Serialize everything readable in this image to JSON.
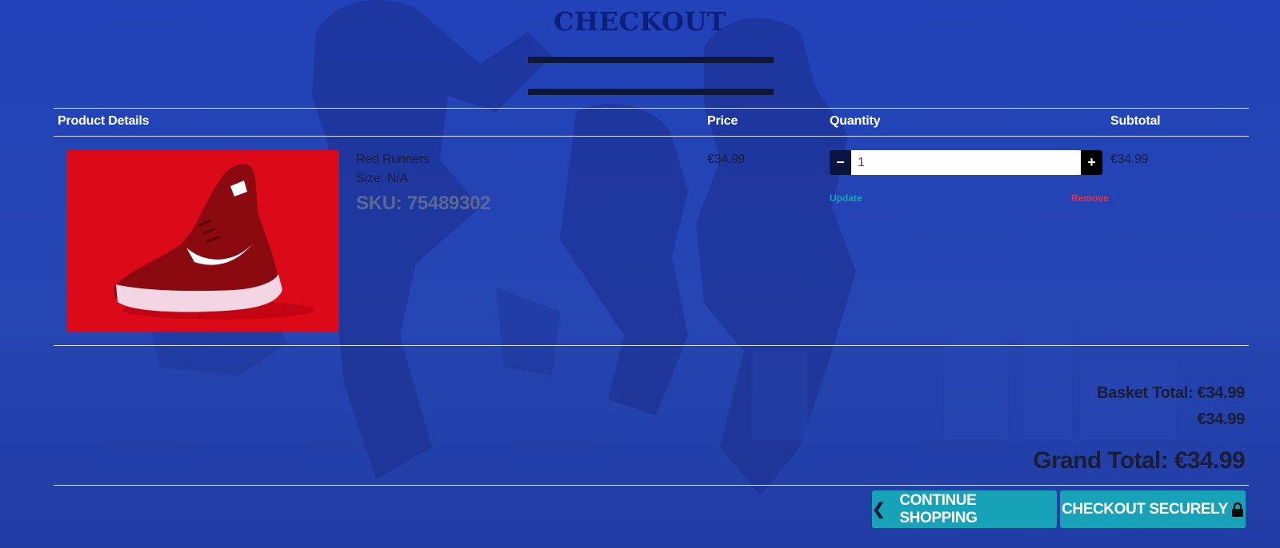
{
  "page": {
    "title": "CHECKOUT"
  },
  "table": {
    "headers": {
      "product_details": "Product Details",
      "price": "Price",
      "quantity": "Quantity",
      "subtotal": "Subtotal"
    }
  },
  "items": [
    {
      "name": "Red Runners",
      "size": "Size: N/A",
      "sku": "SKU: 75489302",
      "price": "€34.99",
      "quantity": "1",
      "subtotal": "€34.99",
      "image_icon": "red-running-shoe-image"
    }
  ],
  "quantity_controls": {
    "decrement_label": "−",
    "increment_label": "+",
    "update_label": "Update",
    "remove_label": "Remove"
  },
  "summary": {
    "basket_total": "Basket Total: €34.99",
    "delivery": "€34.99",
    "grand_total": "Grand Total: €34.99"
  },
  "actions": {
    "continue_label": "CONTINUE SHOPPING",
    "continue_icon": "chevron-left-icon",
    "checkout_label": "CHECKOUT SECURELY",
    "checkout_icon": "lock-icon"
  },
  "colors": {
    "background": "#2243b3",
    "title": "#0d1f7a",
    "button": "#17a2b8",
    "update_link": "#17a2b8",
    "remove_link": "#dc3545"
  }
}
